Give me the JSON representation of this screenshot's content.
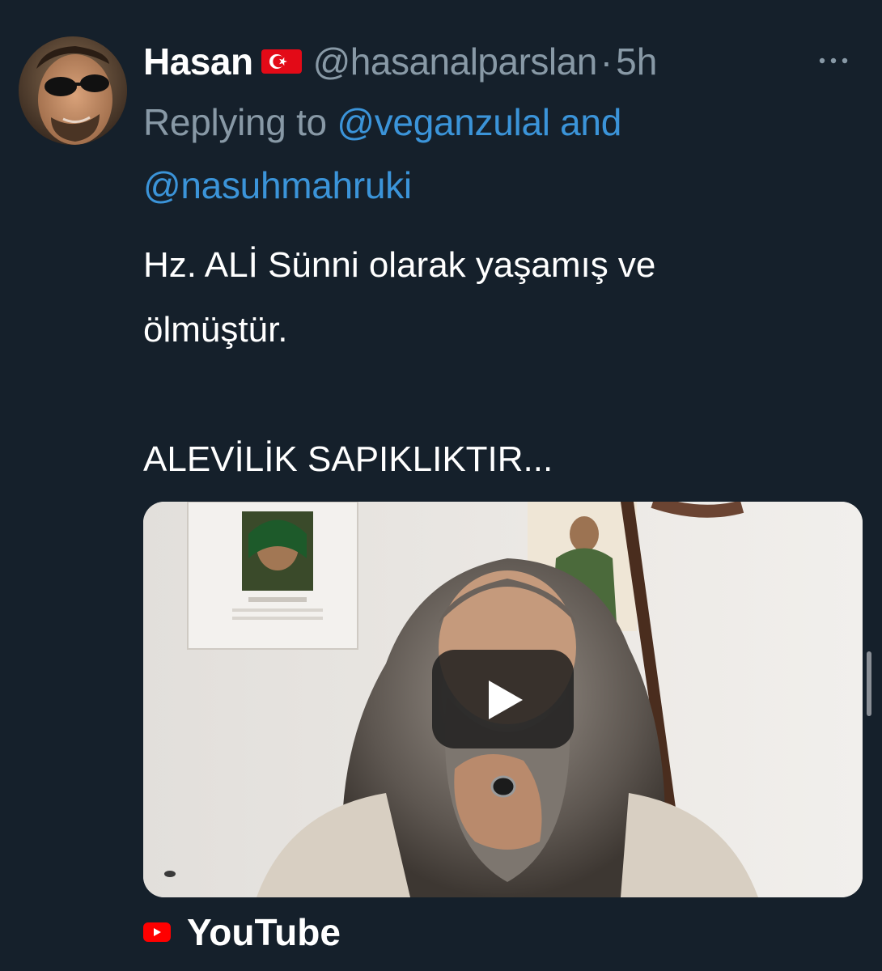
{
  "tweet": {
    "author_name": "Hasan",
    "author_flag": "flag-turkey-icon",
    "handle": "@hasanalparslan",
    "separator": "·",
    "time": "5h",
    "more_icon": "more-horizontal-icon",
    "reply_prefix": "Replying to ",
    "reply_mention_1": "@veganzulal",
    "reply_and": " and",
    "reply_mention_2": "@nasuhmahruki",
    "text_line_1": "Hz. ALİ Sünni olarak yaşamış ve",
    "text_line_2": "ölmüştür.",
    "text_line_3": "ALEVİLİK SAPIKLIKTIR..."
  },
  "media": {
    "type": "video-thumbnail",
    "play_icon": "play-icon"
  },
  "link_source": {
    "icon": "youtube-icon",
    "label": "YouTube"
  },
  "colors": {
    "background": "#15202b",
    "secondary_text": "#8899a6",
    "mention": "#3b94d9",
    "youtube_red": "#ff0000"
  }
}
